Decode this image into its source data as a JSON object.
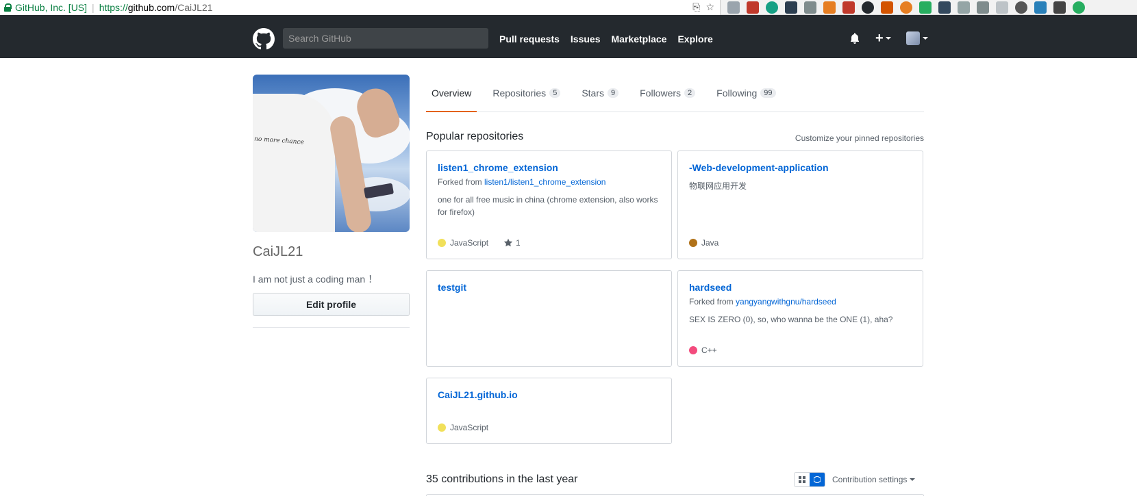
{
  "browser": {
    "secure_label": "GitHub, Inc. [US]",
    "url_scheme": "https://",
    "url_host": "github.com",
    "url_path": "/CaiJL21"
  },
  "header": {
    "search_placeholder": "Search GitHub",
    "nav": [
      "Pull requests",
      "Issues",
      "Marketplace",
      "Explore"
    ]
  },
  "profile": {
    "username": "CaiJL21",
    "bio": "I am not just a coding man ！",
    "edit_button": "Edit profile",
    "shirt_text": "no more chance"
  },
  "tabs": [
    {
      "label": "Overview",
      "count": ""
    },
    {
      "label": "Repositories",
      "count": "5"
    },
    {
      "label": "Stars",
      "count": "9"
    },
    {
      "label": "Followers",
      "count": "2"
    },
    {
      "label": "Following",
      "count": "99"
    }
  ],
  "pinned": {
    "title": "Popular repositories",
    "customize": "Customize your pinned repositories",
    "repos": [
      {
        "name": "listen1_chrome_extension",
        "forked_prefix": "Forked from ",
        "forked_from": "listen1/listen1_chrome_extension",
        "description": "one for all free music in china (chrome extension, also works for firefox)",
        "language": "JavaScript",
        "lang_color": "#f1e05a",
        "stars": "1"
      },
      {
        "name": "-Web-development-application",
        "description": "物联网应用开发",
        "language": "Java",
        "lang_color": "#b07219"
      },
      {
        "name": "testgit"
      },
      {
        "name": "hardseed",
        "forked_prefix": "Forked from ",
        "forked_from": "yangyangwithgnu/hardseed",
        "description": "SEX IS ZERO (0), so, who wanna be the ONE (1), aha?",
        "language": "C++",
        "lang_color": "#f34b7d"
      },
      {
        "name": "CaiJL21.github.io",
        "language": "JavaScript",
        "lang_color": "#f1e05a"
      }
    ]
  },
  "contributions": {
    "title": "35 contributions in the last year",
    "settings": "Contribution settings"
  }
}
